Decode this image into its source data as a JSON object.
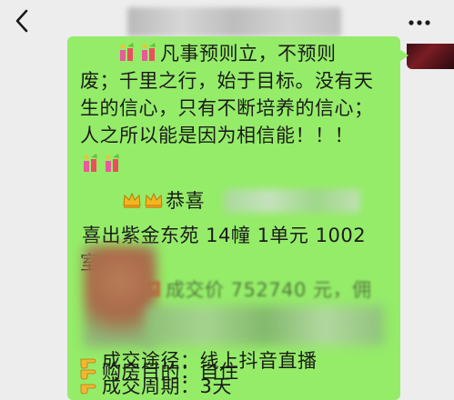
{
  "message": {
    "line1": "凡事预则立，不预则",
    "line2": "废；千里之行，始于目标。没有天",
    "line3": "生的信心，只有不断培养的信心；",
    "line4": "人之所以能是因为相信能！！！",
    "congrats": "恭喜",
    "line6": "喜出紫金东苑 14幢 1单元 1002",
    "line7_start": "室",
    "deal_price": "成交价 752740 元，佣",
    "deal_channel": "成交途径：线上抖音直播",
    "deal_cycle": "成交周期：3天",
    "purchase_purpose": "购房目的：自住"
  },
  "icons": {
    "back": "back-arrow-icon",
    "more": "more-dots-icon",
    "firework": "firework-emoji-icon",
    "crown": "crown-emoji-icon",
    "red_envelope": "red-envelope-emoji-icon",
    "pointing_hand": "pointing-hand-emoji-icon"
  },
  "colors": {
    "bubble": "#95ec69",
    "background": "#ededed",
    "text": "#1b1b1b"
  }
}
